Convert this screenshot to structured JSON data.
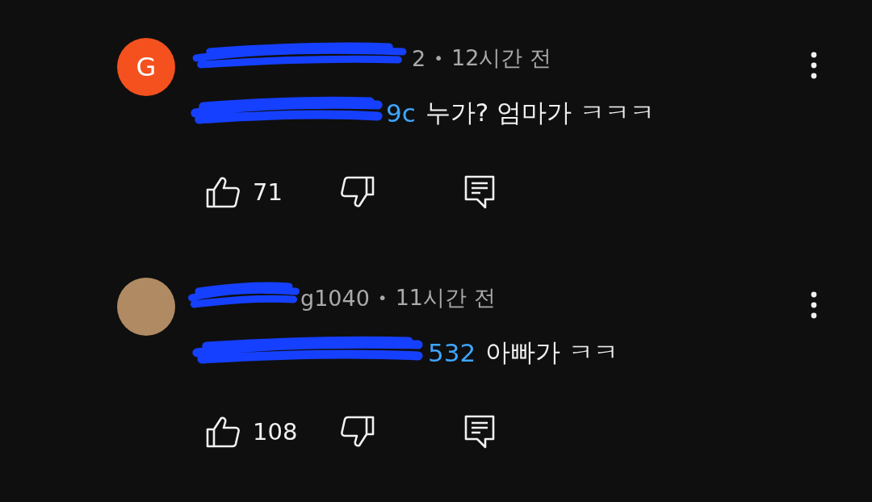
{
  "comments": [
    {
      "avatar": {
        "kind": "letter",
        "letter": "G",
        "color": "#f4511e"
      },
      "author_visible": "2",
      "separator": "•",
      "time": "12시간 전",
      "mention_visible": "9c",
      "text": "누가? 엄마가 ㅋㅋㅋ",
      "likes": "71"
    },
    {
      "avatar": {
        "kind": "photo",
        "color": "#b08a62"
      },
      "author_visible": "g1040",
      "separator": "•",
      "time": "11시간 전",
      "mention_visible": "532",
      "text": "아빠가 ㅋㅋ",
      "likes": "108"
    }
  ]
}
